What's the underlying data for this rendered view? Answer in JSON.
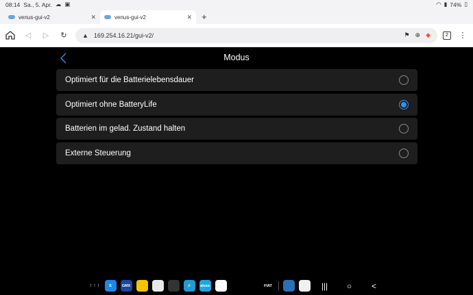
{
  "status": {
    "time": "08:14",
    "date": "Sa., 5. Apr.",
    "battery": "74%"
  },
  "tabs": [
    {
      "title": "venus-gui-v2",
      "close": "✕"
    },
    {
      "title": "venus-gui-v2",
      "close": "✕"
    }
  ],
  "newtab": "+",
  "toolbar": {
    "url": "169.254.16.21/gui-v2/",
    "tab_count": "2"
  },
  "page": {
    "title": "Modus",
    "options": [
      {
        "label": "Optimiert für die Batterielebensdauer",
        "selected": false
      },
      {
        "label": "Optimiert ohne BatteryLife",
        "selected": true
      },
      {
        "label": "Batterien im gelad. Zustand halten",
        "selected": false
      },
      {
        "label": "Externe Steuerung",
        "selected": false
      }
    ]
  },
  "dock": {
    "apps": [
      {
        "name": "apps-grid-icon",
        "bg": "#000000",
        "text": "⋮⋮⋮"
      },
      {
        "name": "app-s-icon",
        "bg": "#1e88e5",
        "text": "S"
      },
      {
        "name": "app-gmx-icon",
        "bg": "#1c449b",
        "text": "GMX"
      },
      {
        "name": "app-bank-icon",
        "bg": "#f5c400",
        "text": ""
      },
      {
        "name": "app-record-icon",
        "bg": "#e8e8e8",
        "text": ""
      },
      {
        "name": "app-dot-icon",
        "bg": "#333333",
        "text": ""
      },
      {
        "name": "app-bolt-icon",
        "bg": "#1e9bd7",
        "text": "⚡"
      },
      {
        "name": "app-alexa-icon",
        "bg": "#1fa6e0",
        "text": "alexa"
      },
      {
        "name": "app-home-icon",
        "bg": "#ffffff",
        "text": ""
      },
      {
        "name": "app-script-icon",
        "bg": "#000000",
        "text": ""
      },
      {
        "name": "app-loop-icon",
        "bg": "#000000",
        "text": ""
      },
      {
        "name": "app-fiat-icon",
        "bg": "#000000",
        "text": "FIAT"
      },
      {
        "name": "app-victron-icon",
        "bg": "#2c6fb7",
        "text": ""
      },
      {
        "name": "app-homeassistant-icon",
        "bg": "#f0f0f0",
        "text": ""
      }
    ],
    "nav": [
      {
        "name": "recents-button",
        "glyph": "|||"
      },
      {
        "name": "home-button",
        "glyph": "○"
      },
      {
        "name": "back-nav-button",
        "glyph": "<"
      }
    ]
  }
}
